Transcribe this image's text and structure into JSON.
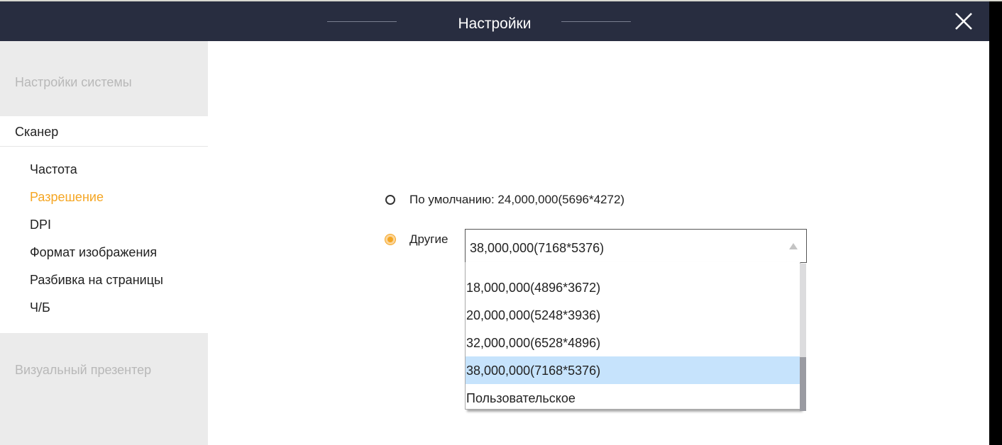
{
  "window": {
    "title": "Настройки"
  },
  "sidebar": {
    "sections": [
      "Настройки системы",
      "Сканер",
      "Визуальный презентер"
    ],
    "scanner_items": [
      {
        "label": "Частота",
        "active": false
      },
      {
        "label": "Разрешение",
        "active": true
      },
      {
        "label": "DPI",
        "active": false
      },
      {
        "label": "Формат изображения",
        "active": false
      },
      {
        "label": "Разбивка на страницы",
        "active": false
      },
      {
        "label": "Ч/Б",
        "active": false
      }
    ]
  },
  "resolution": {
    "default_label": "По умолчанию: 24,000,000(5696*4272)",
    "other_label": "Другие",
    "selected_value": "38,000,000(7168*5376)",
    "options": [
      "18,000,000(4896*3672)",
      "20,000,000(5248*3936)",
      "32,000,000(6528*4896)",
      "38,000,000(7168*5376)",
      "Пользовательское"
    ],
    "selected_index": 3
  },
  "colors": {
    "accent": "#f5a623",
    "titlebar": "#282d40",
    "highlight": "#c6e3fc"
  }
}
